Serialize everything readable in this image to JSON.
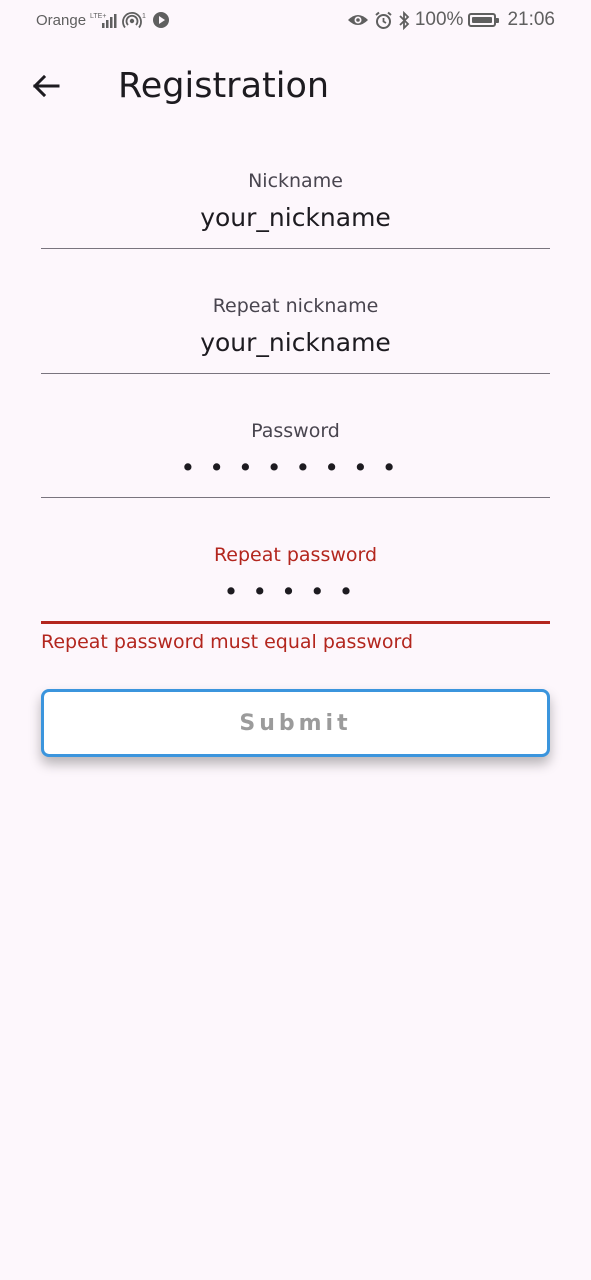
{
  "statusbar": {
    "carrier": "Orange",
    "network": "LTE+",
    "hotspot_count": "1",
    "battery": "100%",
    "time": "21:06",
    "icons": [
      "signal-icon",
      "hotspot-icon",
      "play-icon",
      "eye-icon",
      "alarm-icon",
      "bluetooth-icon",
      "battery-icon"
    ]
  },
  "appbar": {
    "title": "Registration",
    "back_icon": "arrow-back-icon"
  },
  "form": {
    "nickname": {
      "label": "Nickname",
      "value": "your_nickname"
    },
    "repeat_nickname": {
      "label": "Repeat nickname",
      "value": "your_nickname"
    },
    "password": {
      "label": "Password",
      "masked_value": "••••••••"
    },
    "repeat_password": {
      "label": "Repeat password",
      "masked_value": "•••••",
      "error": "Repeat password must equal password"
    },
    "submit_label": "Submit"
  },
  "colors": {
    "background": "#fdf7fc",
    "error": "#b3261e",
    "submit_border": "#3b95dd",
    "submit_text": "#9b9b9b"
  }
}
